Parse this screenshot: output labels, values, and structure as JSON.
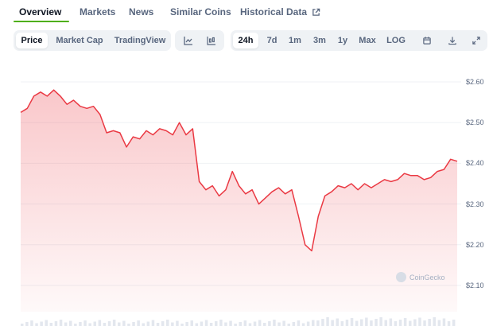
{
  "nav": {
    "tabs": [
      {
        "label": "Overview"
      },
      {
        "label": "Markets"
      },
      {
        "label": "News"
      },
      {
        "label": "Similar Coins"
      },
      {
        "label": "Historical Data"
      }
    ]
  },
  "toolbar": {
    "views": [
      "Price",
      "Market Cap",
      "TradingView"
    ],
    "ranges": [
      "24h",
      "7d",
      "1m",
      "3m",
      "1y",
      "Max",
      "LOG"
    ],
    "chart_style_icons": [
      "line-chart-icon",
      "candlestick-icon"
    ],
    "tool_icons": [
      "calendar-icon",
      "download-icon",
      "expand-icon"
    ],
    "active_view": "Price",
    "active_range": "24h"
  },
  "watermark": {
    "label": "CoinGecko"
  },
  "colors": {
    "line": "#ea3943",
    "fill": "#ea3943",
    "active_tab": "#4eaf0a"
  },
  "chart_data": {
    "type": "area",
    "y_ticks": [
      "$2.60",
      "$2.50",
      "$2.40",
      "$2.30",
      "$2.20",
      "$2.10"
    ],
    "ylim": [
      2.1,
      2.6
    ],
    "grid": true,
    "y_axis_position": "right",
    "values": [
      2.525,
      2.535,
      2.565,
      2.575,
      2.565,
      2.58,
      2.565,
      2.545,
      2.555,
      2.54,
      2.535,
      2.54,
      2.52,
      2.475,
      2.48,
      2.475,
      2.44,
      2.465,
      2.46,
      2.48,
      2.47,
      2.485,
      2.48,
      2.47,
      2.5,
      2.47,
      2.485,
      2.355,
      2.335,
      2.345,
      2.32,
      2.335,
      2.38,
      2.345,
      2.325,
      2.335,
      2.3,
      2.315,
      2.33,
      2.34,
      2.325,
      2.335,
      2.27,
      2.2,
      2.185,
      2.27,
      2.32,
      2.33,
      2.345,
      2.34,
      2.35,
      2.335,
      2.35,
      2.34,
      2.35,
      2.36,
      2.355,
      2.36,
      2.375,
      2.37,
      2.37,
      2.36,
      2.365,
      2.38,
      2.385,
      2.41,
      2.405
    ]
  }
}
